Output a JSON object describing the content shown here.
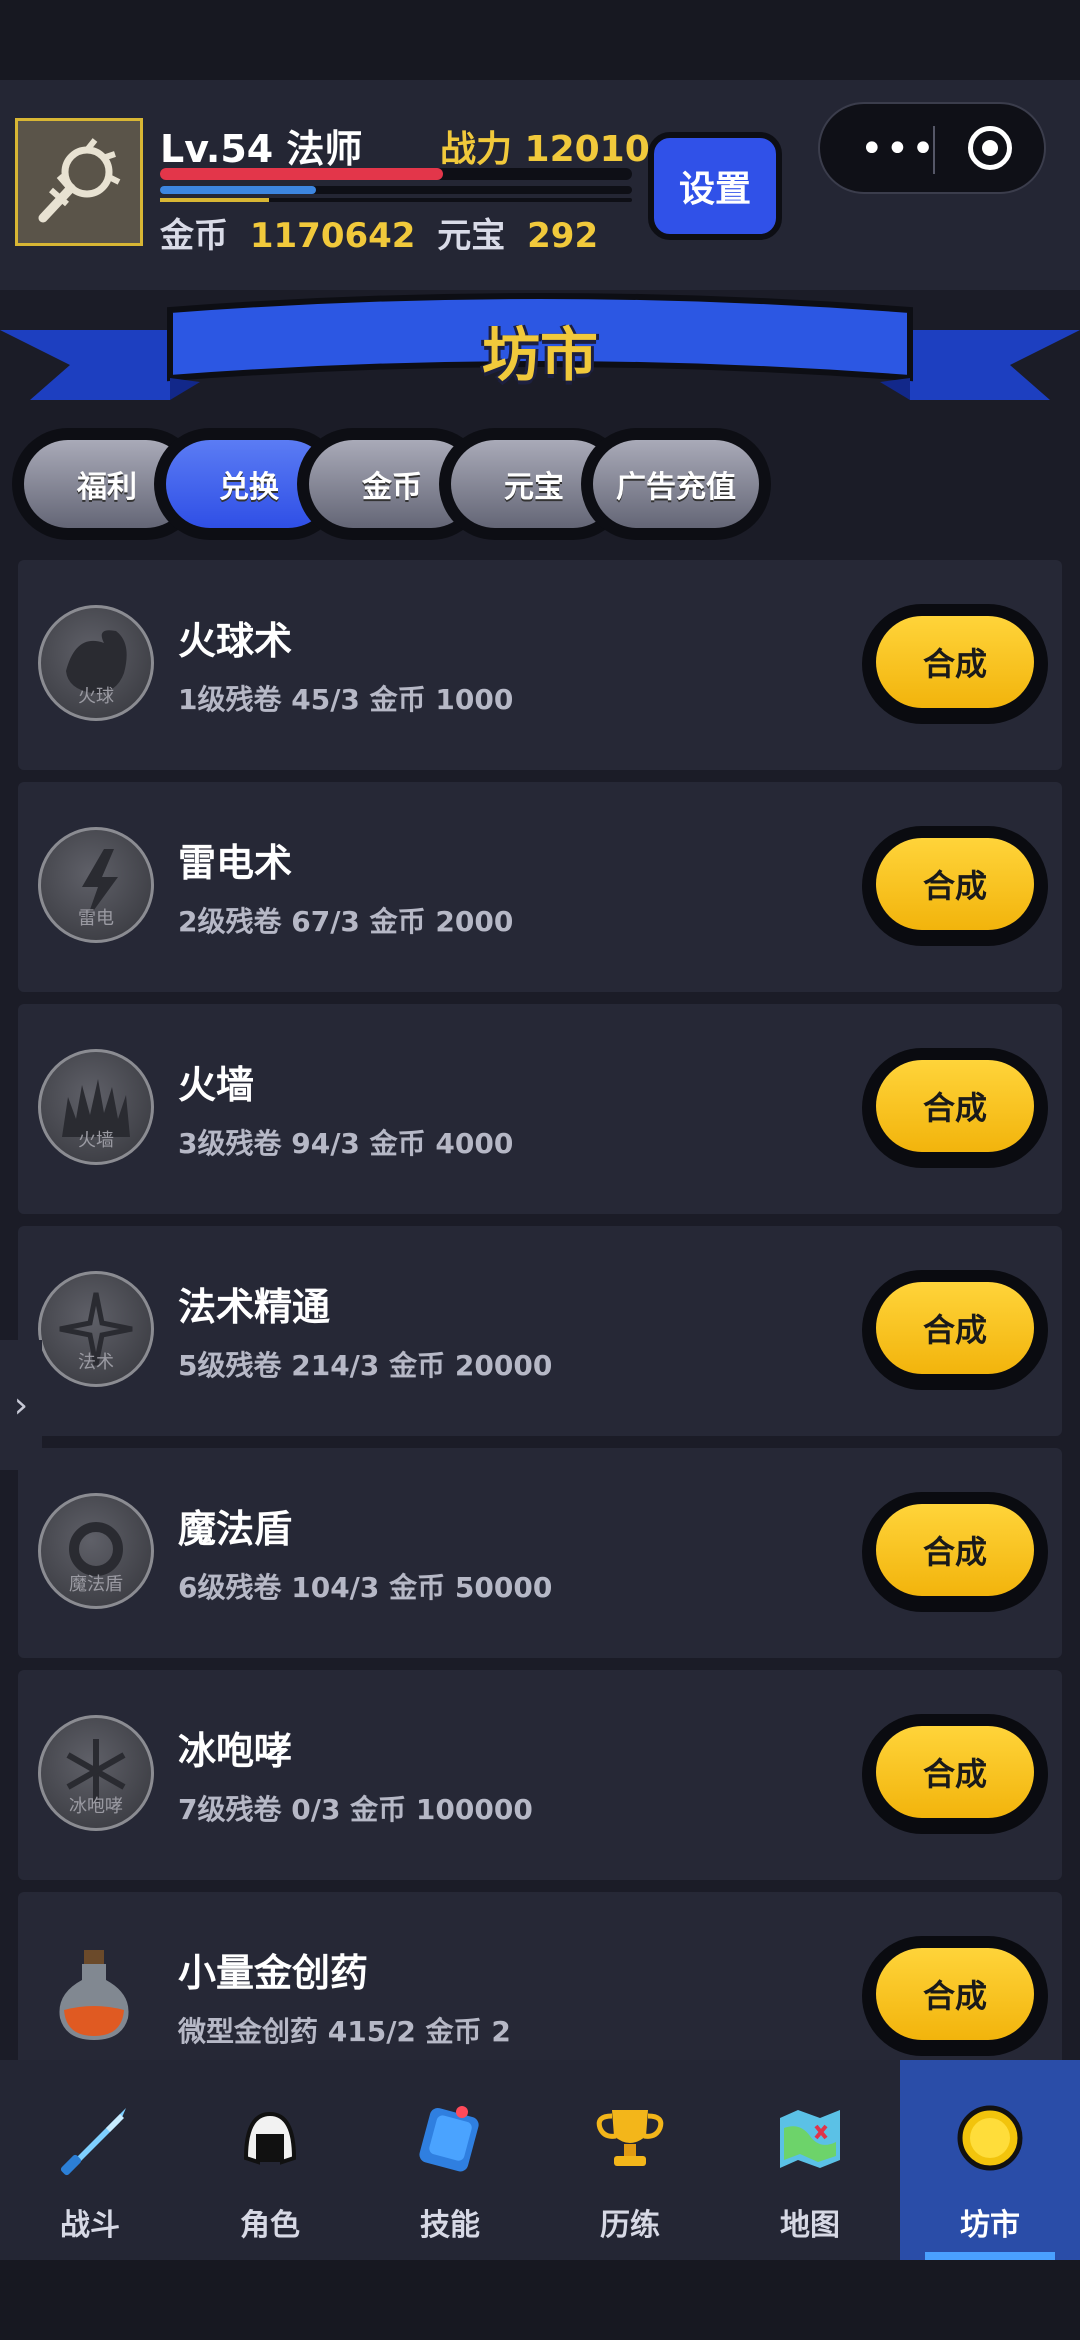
{
  "player": {
    "level_text": "Lv.54 法师",
    "power_text": "战力 12010",
    "hp_fraction": 0.6,
    "mp_fraction": 0.33,
    "xp_fraction": 0.23,
    "gold_label": "金币",
    "gold_value": "1170642",
    "ingot_label": "元宝",
    "ingot_value": "292"
  },
  "header": {
    "settings_label": "设置"
  },
  "banner": {
    "title": "坊市"
  },
  "tabs": [
    {
      "label": "福利",
      "active": false
    },
    {
      "label": "兑换",
      "active": true
    },
    {
      "label": "金币",
      "active": false
    },
    {
      "label": "元宝",
      "active": false
    },
    {
      "label": "广告充值",
      "active": false
    }
  ],
  "items": [
    {
      "name": "火球术",
      "detail": "1级残卷 45/3  金币 1000",
      "icon_label": "火球",
      "icon": "fireball-icon",
      "button": "合成"
    },
    {
      "name": "雷电术",
      "detail": "2级残卷 67/3  金币 2000",
      "icon_label": "雷电",
      "icon": "lightning-icon",
      "button": "合成"
    },
    {
      "name": "火墙",
      "detail": "3级残卷 94/3  金币 4000",
      "icon_label": "火墙",
      "icon": "firewall-icon",
      "button": "合成"
    },
    {
      "name": "法术精通",
      "detail": "5级残卷 214/3  金币 20000",
      "icon_label": "法术",
      "icon": "spell-mastery-icon",
      "button": "合成"
    },
    {
      "name": "魔法盾",
      "detail": "6级残卷 104/3  金币 50000",
      "icon_label": "魔法盾",
      "icon": "magic-shield-icon",
      "button": "合成"
    },
    {
      "name": "冰咆哮",
      "detail": "7级残卷 0/3  金币 100000",
      "icon_label": "冰咆哮",
      "icon": "ice-roar-icon",
      "button": "合成"
    },
    {
      "name": "小量金创药",
      "detail": "微型金创药 415/2  金币 2",
      "icon_label": "",
      "icon": "potion-icon",
      "button": "合成"
    }
  ],
  "nav": [
    {
      "label": "战斗",
      "icon": "sword-icon",
      "active": false
    },
    {
      "label": "角色",
      "icon": "helmet-icon",
      "active": false
    },
    {
      "label": "技能",
      "icon": "skill-book-icon",
      "active": false
    },
    {
      "label": "历练",
      "icon": "trophy-icon",
      "active": false
    },
    {
      "label": "地图",
      "icon": "map-icon",
      "active": false
    },
    {
      "label": "坊市",
      "icon": "coin-icon",
      "active": true
    }
  ],
  "colors": {
    "accent_gold": "#f1c93b",
    "button_yellow": "#ffd43a",
    "tab_active": "#3051e8",
    "nav_active": "#2a4da8",
    "hp": "#e3364a",
    "mp": "#3d86e0"
  }
}
